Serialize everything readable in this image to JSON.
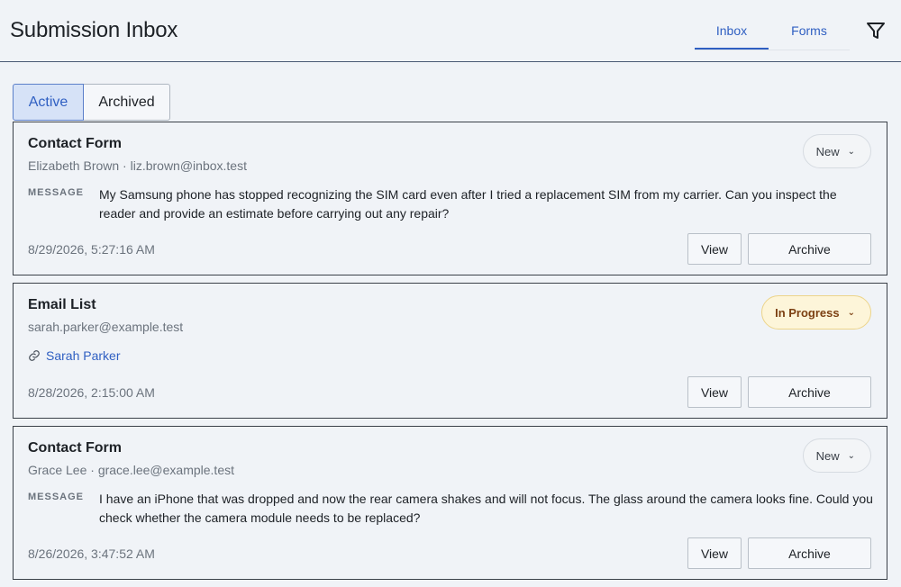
{
  "header": {
    "title": "Submission Inbox",
    "tabs": [
      {
        "label": "Inbox",
        "active": true
      },
      {
        "label": "Forms",
        "active": false
      }
    ],
    "filter_icon": "filter-icon"
  },
  "view_toggle": {
    "options": [
      "Active",
      "Archived"
    ],
    "selected": "Active"
  },
  "cards": [
    {
      "title": "Contact Form",
      "subtitle": "Elizabeth Brown · liz.brown@inbox.test",
      "status": "New",
      "message_label": "MESSAGE",
      "message": "My Samsung phone has stopped recognizing the SIM card even after I tried a replacement SIM from my carrier. Can you inspect the reader and provide an estimate before carrying out any repair?",
      "date": "8/29/2026, 5:27:16 AM",
      "view_label": "View",
      "archive_label": "Archive"
    },
    {
      "title": "Email List",
      "subtitle": "sarah.parker@example.test",
      "status": "In Progress",
      "link_label": "Sarah Parker",
      "date": "8/28/2026, 2:15:00 AM",
      "view_label": "View",
      "archive_label": "Archive"
    },
    {
      "title": "Contact Form",
      "subtitle": "Grace Lee · grace.lee@example.test",
      "status": "New",
      "message_label": "MESSAGE",
      "message": "I have an iPhone that was dropped and now the rear camera shakes and will not focus. The glass around the camera looks fine. Could you check whether the camera module needs to be replaced?",
      "date": "8/26/2026, 3:47:52 AM",
      "view_label": "View",
      "archive_label": "Archive"
    }
  ],
  "colors": {
    "accent": "#2f5fc2",
    "background": "#f0f3f7",
    "in_progress_bg": "#fdf5d9",
    "in_progress_text": "#7c4012"
  }
}
